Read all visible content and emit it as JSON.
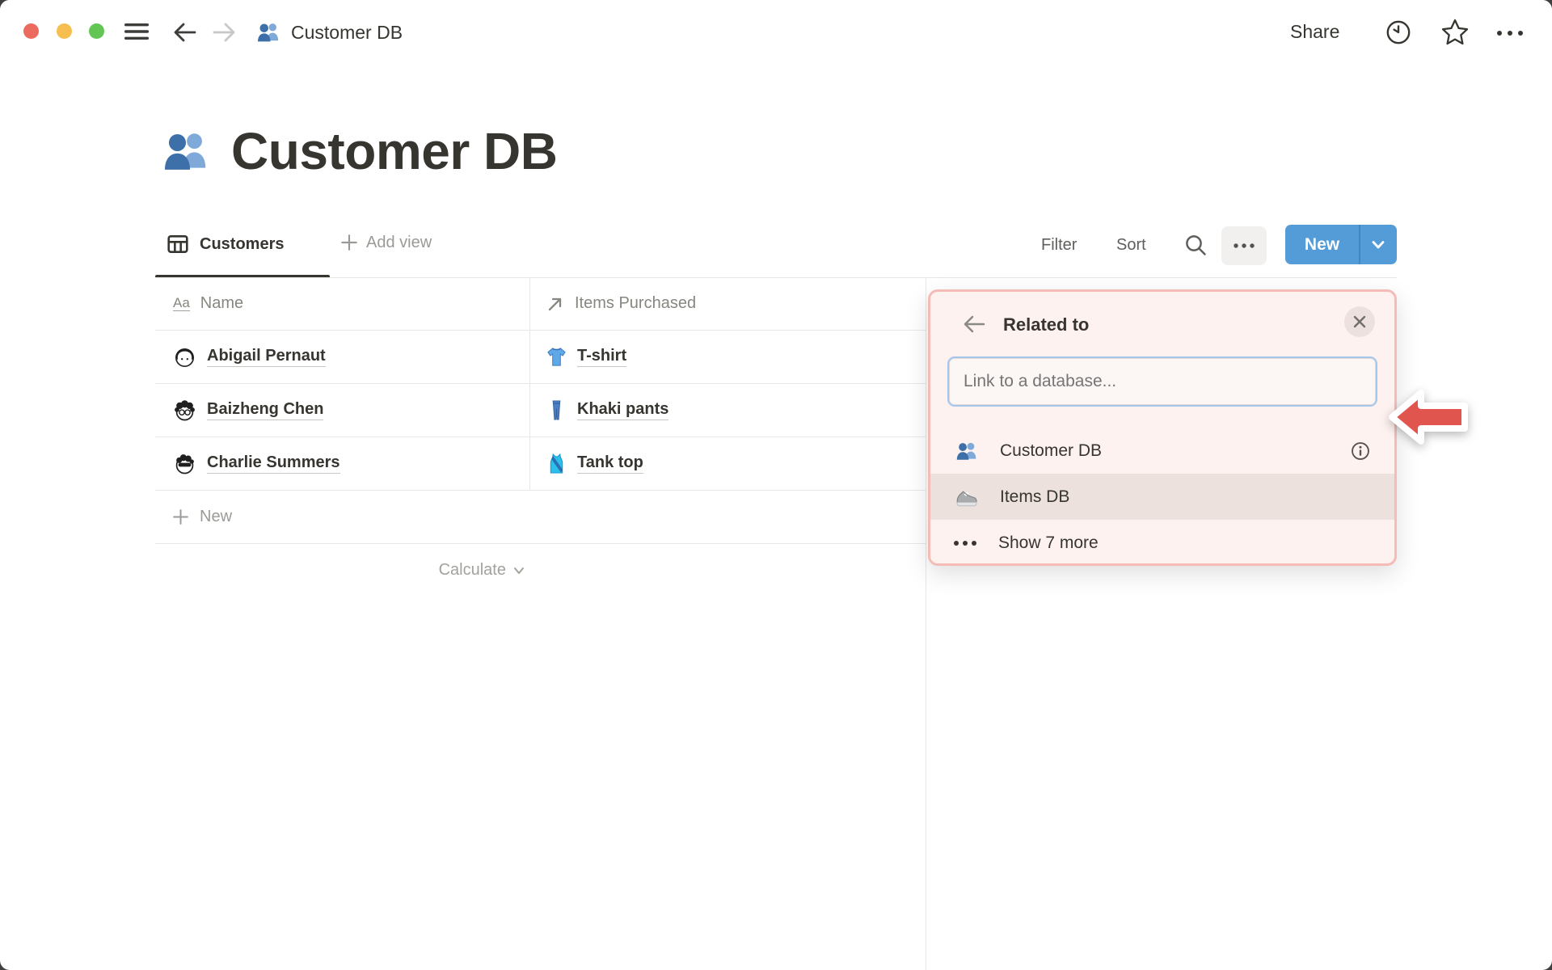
{
  "topbar": {
    "breadcrumb_title": "Customer DB",
    "share_label": "Share"
  },
  "page": {
    "title": "Customer DB"
  },
  "toolbar": {
    "tab_label": "Customers",
    "add_view_label": "Add view",
    "filter_label": "Filter",
    "sort_label": "Sort",
    "new_label": "New"
  },
  "table": {
    "columns": [
      {
        "label": "Name",
        "icon": "title-property",
        "icon_glyph": "Aa"
      },
      {
        "label": "Items Purchased",
        "icon": "relation-property"
      }
    ],
    "rows": [
      {
        "name": "Abigail Pernaut",
        "item": "T-shirt",
        "item_icon": "t-shirt-emoji"
      },
      {
        "name": "Baizheng Chen",
        "item": "Khaki pants",
        "item_icon": "jeans-emoji"
      },
      {
        "name": "Charlie Summers",
        "item": "Tank top",
        "item_icon": "tank-top-emoji"
      }
    ],
    "new_row_label": "New",
    "calculate_label": "Calculate"
  },
  "popup": {
    "title": "Related to",
    "search_placeholder": "Link to a database...",
    "options": [
      {
        "label": "Customer DB",
        "icon": "people-emoji",
        "has_info": true
      },
      {
        "label": "Items DB",
        "icon": "sneaker-emoji",
        "highlighted": true
      }
    ],
    "show_more_label": "Show 7 more"
  },
  "colors": {
    "accent_blue": "#549CD7",
    "panel_border": "#F4BBB7",
    "panel_bg": "#FDF2F0",
    "highlight_row": "#EDE1DE",
    "annotation_arrow": "#E0564E",
    "traffic_red": "#EC6A5E",
    "traffic_yellow": "#F5BE4F",
    "traffic_green": "#62C554"
  }
}
